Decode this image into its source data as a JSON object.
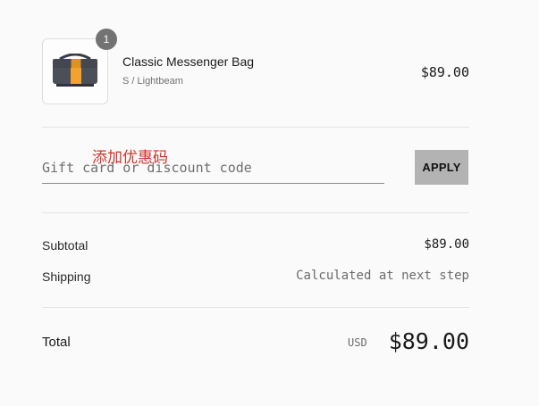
{
  "cart": {
    "item": {
      "name": "Classic Messenger Bag",
      "variant": "S / Lightbeam",
      "price": "$89.00",
      "quantity": "1",
      "image_icon": "messenger-bag-icon"
    }
  },
  "discount": {
    "annotation": "添加优惠码",
    "placeholder": "Gift card or discount code",
    "apply_label": "APPLY"
  },
  "summary": {
    "subtotal_label": "Subtotal",
    "subtotal_value": "$89.00",
    "shipping_label": "Shipping",
    "shipping_value": "Calculated at next step",
    "total_label": "Total",
    "currency": "USD",
    "total_value": "$89.00"
  },
  "colors": {
    "bag_body": "#4b4f58",
    "bag_stripe": "#f2a22d",
    "annotation": "#d6302a",
    "apply_bg": "#b3b3b3"
  }
}
